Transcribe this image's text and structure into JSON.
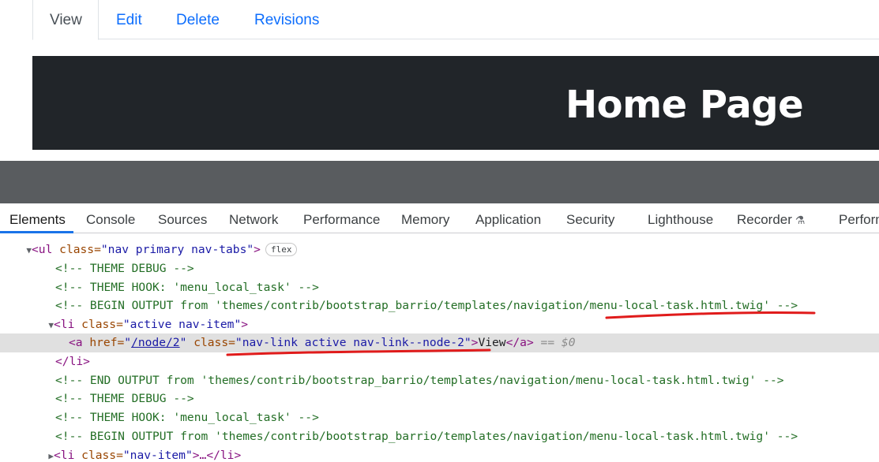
{
  "page": {
    "tabs": [
      {
        "label": "View",
        "active": true
      },
      {
        "label": "Edit"
      },
      {
        "label": "Delete"
      },
      {
        "label": "Revisions"
      }
    ],
    "hero_title": "Home Page"
  },
  "devtools": {
    "tabs": [
      "Elements",
      "Console",
      "Sources",
      "Network",
      "Performance",
      "Memory",
      "Application",
      "Security",
      "Lighthouse",
      "Recorder",
      "Perform"
    ],
    "recorder_icon": "flask-icon",
    "badge": "flex",
    "code": {
      "l1_open": "<ul ",
      "l1_attr": "class=",
      "l1_val": "\"nav primary nav-tabs\"",
      "l1_close": ">",
      "l2": "<!-- THEME DEBUG -->",
      "l3": "<!-- THEME HOOK: 'menu_local_task' -->",
      "l4": "<!-- BEGIN OUTPUT from 'themes/contrib/bootstrap_barrio/templates/navigation/menu-local-task.html.twig' -->",
      "l5_open": "<li ",
      "l5_attr": "class=",
      "l5_val": "\"active nav-item\"",
      "l5_close": ">",
      "l6_open": "<a ",
      "l6_attr1": "href=",
      "l6_q1": "\"",
      "l6_link": "/node/2",
      "l6_q2": "\"",
      "l6_attr2": " class=",
      "l6_val2": "\"nav-link active nav-link--node-2\"",
      "l6_gt": ">",
      "l6_text": "View",
      "l6_end": "</a>",
      "l6_eq": " == $0",
      "l7": "</li>",
      "l8": "<!-- END OUTPUT from 'themes/contrib/bootstrap_barrio/templates/navigation/menu-local-task.html.twig' -->",
      "l9": "<!-- THEME DEBUG -->",
      "l10": "<!-- THEME HOOK: 'menu_local_task' -->",
      "l11": "<!-- BEGIN OUTPUT from 'themes/contrib/bootstrap_barrio/templates/navigation/menu-local-task.html.twig' -->",
      "l12_open": "<li ",
      "l12_attr": "class=",
      "l12_val": "\"nav-item\"",
      "l12_close": ">…</li>"
    }
  },
  "colors": {
    "annotation": "#e01b1b",
    "hero_bg": "#212529",
    "devtools_accent": "#1a73e8"
  }
}
